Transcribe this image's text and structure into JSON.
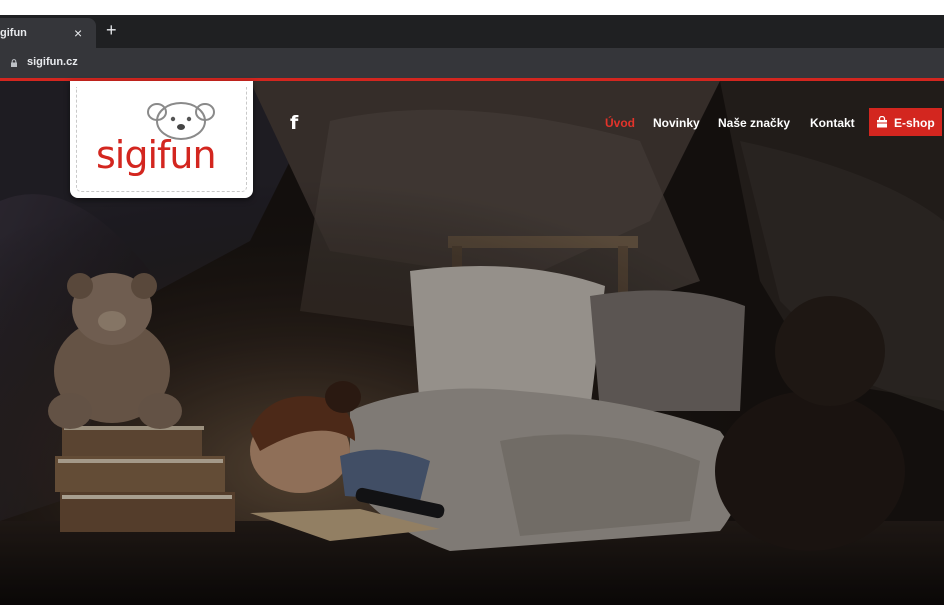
{
  "browser": {
    "tab_title": "gifun",
    "tab_close": "×",
    "new_tab": "+",
    "url": "sigifun.cz"
  },
  "site": {
    "logo_text": "sigifun",
    "facebook_icon": "f",
    "nav": [
      {
        "label": "Úvod",
        "active": true
      },
      {
        "label": "Novinky",
        "active": false
      },
      {
        "label": "Naše značky",
        "active": false
      },
      {
        "label": "Kontakt",
        "active": false
      }
    ],
    "eshop_label": "E-shop",
    "colors": {
      "brand_red": "#d3261f",
      "active_nav": "#e3332a"
    }
  }
}
